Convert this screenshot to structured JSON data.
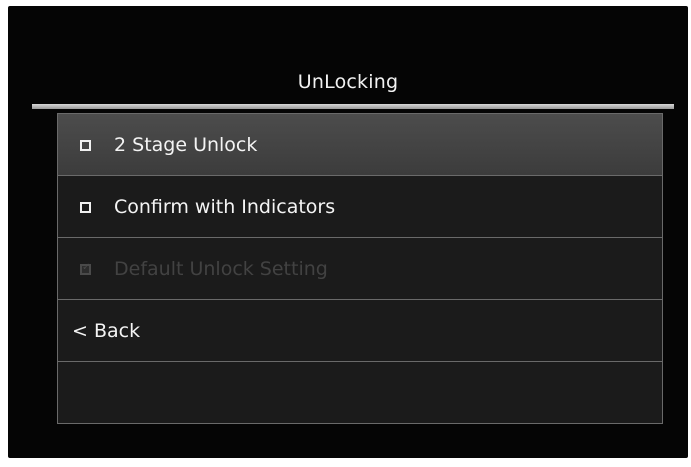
{
  "screen": {
    "title": "UnLocking"
  },
  "menu": {
    "items": [
      {
        "label": "2 Stage Unlock",
        "checked": false,
        "selected": true,
        "enabled": true
      },
      {
        "label": "Confirm with Indicators",
        "checked": false,
        "selected": false,
        "enabled": true
      },
      {
        "label": "Default Unlock Setting",
        "checked": true,
        "selected": false,
        "enabled": false
      }
    ],
    "back_label": "< Back"
  },
  "colors": {
    "background": "#050505",
    "menu_background": "#1b1b1b",
    "selected_row": "#444444",
    "divider": "#6a6a6a",
    "text": "#f4f4f4",
    "disabled_text": "#424242"
  }
}
